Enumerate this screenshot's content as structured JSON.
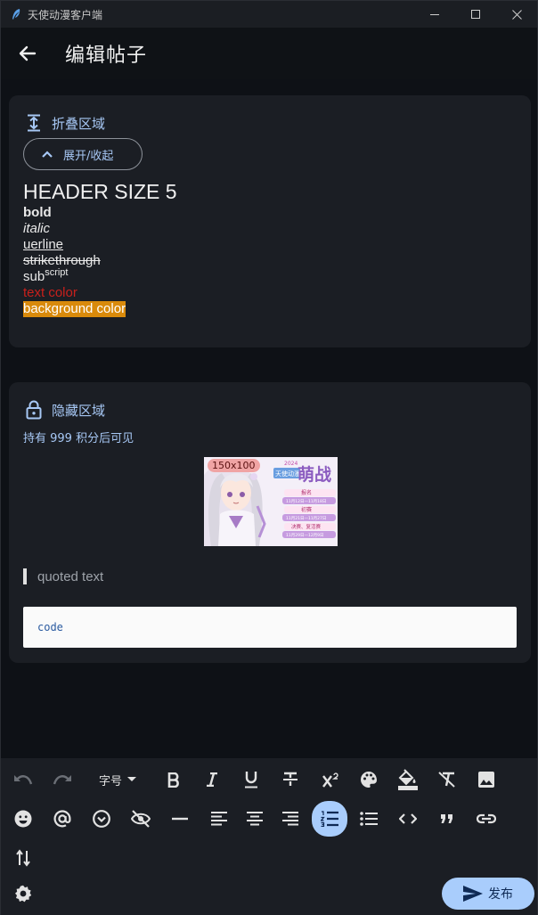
{
  "window": {
    "title": "天使动漫客户端"
  },
  "appbar": {
    "title": "编辑帖子"
  },
  "collapse_block": {
    "label": "折叠区域",
    "toggle_label": "展开/收起",
    "header": "HEADER SIZE 5",
    "bold": "bold",
    "italic": "italic",
    "underline": "uerline",
    "strikethrough": "strikethrough",
    "sub": "sub",
    "superscript": "script",
    "text_color": "text color",
    "background_color": "background color",
    "text_color_value": "#c8201c",
    "background_color_value": "#d98a0b"
  },
  "hidden_block": {
    "label": "隐藏区域",
    "points_text": "持有 999 积分后可见",
    "image_badge": "150x100",
    "image_title": "萌战",
    "image_year": "2024",
    "image_brand": "天使动漫",
    "image_lines": [
      "报名",
      "11月12日—11月18日",
      "初赛",
      "11月21日—11月27日",
      "决赛、复活赛",
      "11月29日—12月9日"
    ],
    "quote": "quoted text",
    "code": "code"
  },
  "toolbar": {
    "font_size_label": "字号",
    "publish_label": "发布",
    "icons": [
      "undo-icon",
      "redo-icon",
      "bold-icon",
      "italic-icon",
      "underline-icon",
      "strikethrough-icon",
      "superscript-icon",
      "palette-icon",
      "fill-color-icon",
      "clear-format-icon",
      "image-icon",
      "emoji-icon",
      "mention-icon",
      "dropdown-circle-icon",
      "hide-icon",
      "horizontal-rule-icon",
      "align-left-icon",
      "align-center-icon",
      "align-right-icon",
      "ordered-list-icon",
      "unordered-list-icon",
      "code-icon",
      "quote-icon",
      "link-icon",
      "swap-icon",
      "settings-icon"
    ]
  },
  "colors": {
    "accent": "#a9cdfc",
    "accent_text": "#a7c8f5",
    "card": "#1b1e24",
    "background": "#0e1116"
  }
}
